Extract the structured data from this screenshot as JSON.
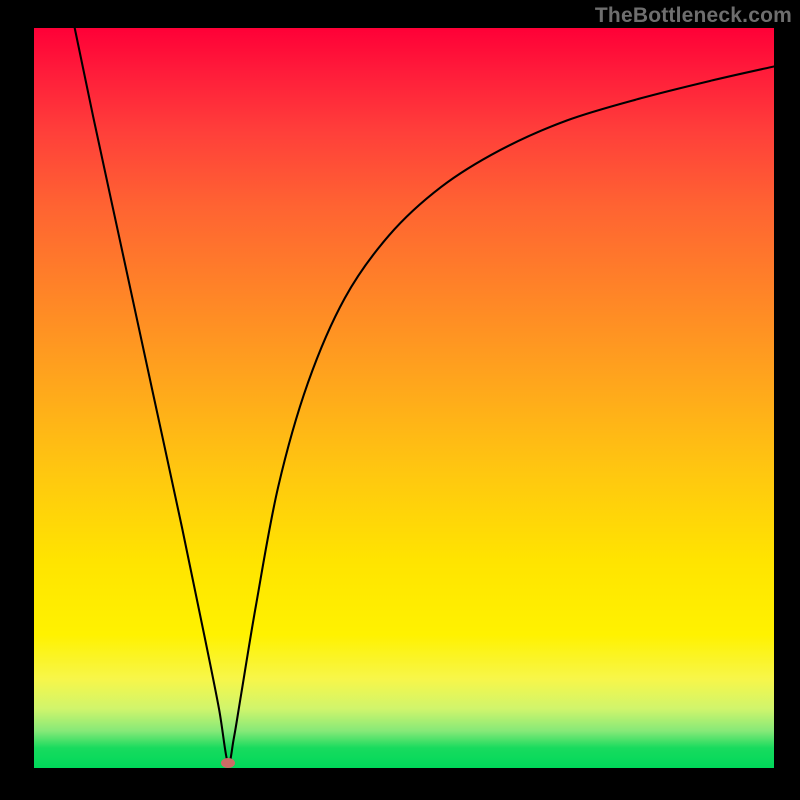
{
  "watermark": "TheBottleneck.com",
  "chart_data": {
    "type": "line",
    "title": "",
    "xlabel": "",
    "ylabel": "",
    "xlim": [
      0,
      100
    ],
    "ylim": [
      0,
      100
    ],
    "x": [
      5.5,
      8,
      12,
      16,
      20,
      23,
      25,
      26.2,
      27,
      28,
      30,
      33,
      37,
      42,
      48,
      55,
      63,
      72,
      82,
      92,
      100
    ],
    "y": [
      100,
      88,
      69.5,
      51,
      32.5,
      18,
      8,
      0.7,
      4,
      10,
      22,
      38,
      52,
      63.5,
      72,
      78.5,
      83.5,
      87.5,
      90.5,
      93,
      94.8
    ],
    "marker": {
      "x": 26.2,
      "y": 0.7
    },
    "background_gradient": {
      "top_color": "#ff0037",
      "bottom_color": "#00d85a",
      "stops": [
        "red",
        "orange",
        "yellow",
        "green"
      ]
    }
  }
}
